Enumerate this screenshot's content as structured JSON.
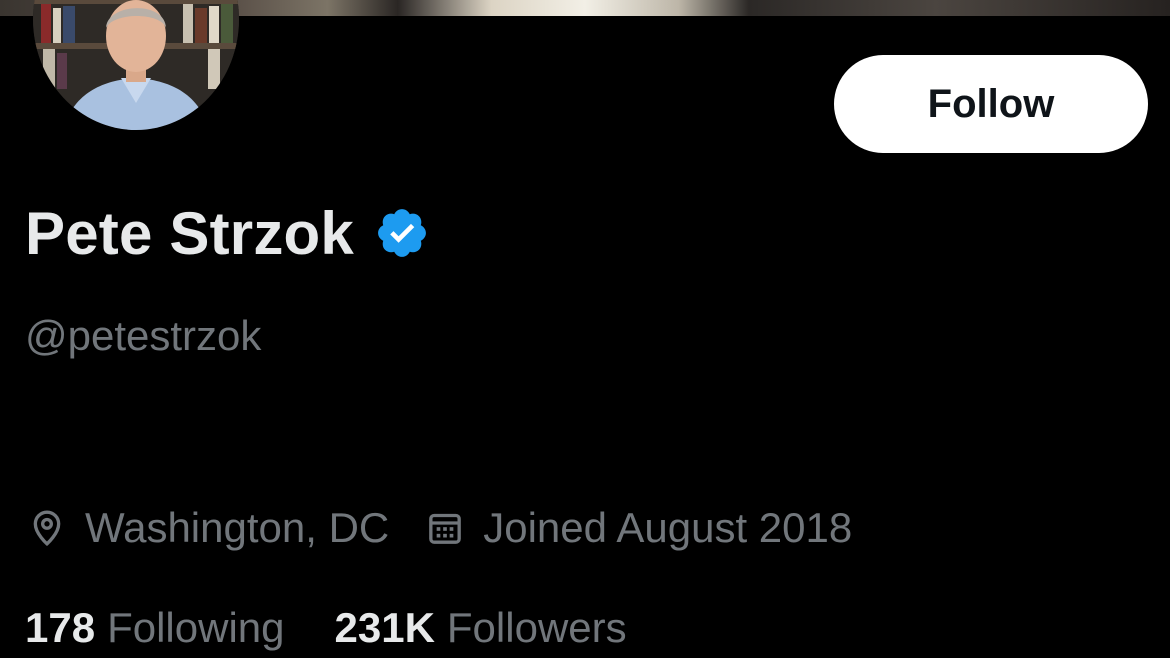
{
  "profile": {
    "display_name": "Pete Strzok",
    "handle": "@petestrzok",
    "verified": true,
    "follow_label": "Follow",
    "location": "Washington, DC",
    "joined": "Joined August 2018"
  },
  "stats": {
    "following_count": "178",
    "following_label": "Following",
    "followers_count": "231K",
    "followers_label": "Followers"
  },
  "icons": {
    "verified": "verified-badge-icon",
    "location": "location-pin-icon",
    "calendar": "calendar-icon"
  },
  "colors": {
    "background": "#000000",
    "text_primary": "#e7e9ea",
    "text_secondary": "#71767b",
    "verified_blue": "#1d9bf0",
    "follow_button_bg": "#ffffff"
  }
}
